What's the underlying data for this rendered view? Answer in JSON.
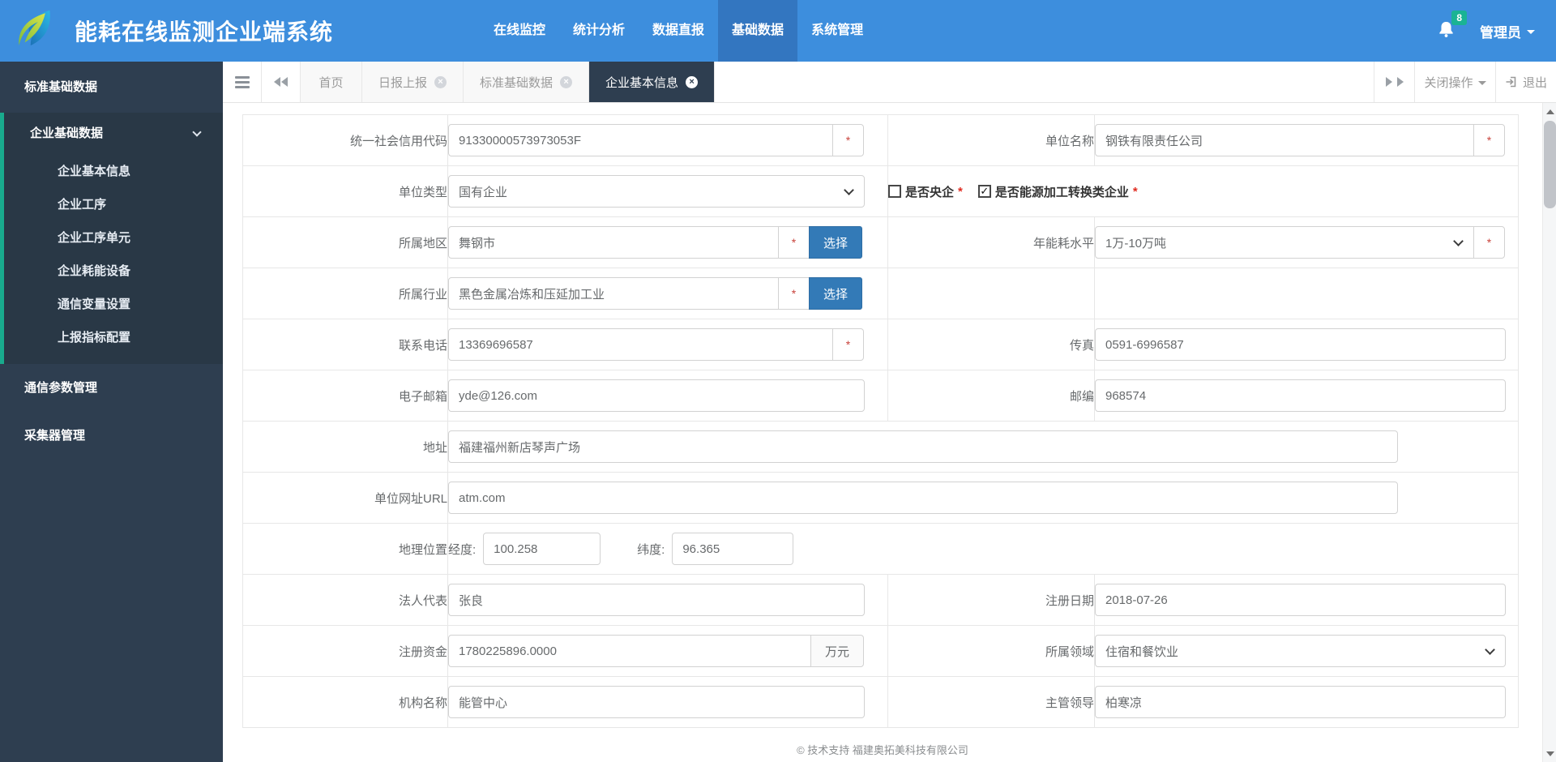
{
  "header": {
    "title": "能耗在线监测企业端系统",
    "nav": [
      {
        "label": "在线监控",
        "active": false
      },
      {
        "label": "统计分析",
        "active": false
      },
      {
        "label": "数据直报",
        "active": false
      },
      {
        "label": "基础数据",
        "active": true
      },
      {
        "label": "系统管理",
        "active": false
      }
    ],
    "badge": "8",
    "user": "管理员"
  },
  "tabbar": {
    "tabs": [
      {
        "label": "首页",
        "closable": false,
        "active": false
      },
      {
        "label": "日报上报",
        "closable": true,
        "active": false
      },
      {
        "label": "标准基础数据",
        "closable": true,
        "active": false
      },
      {
        "label": "企业基本信息",
        "closable": true,
        "active": true
      }
    ],
    "close_menu": "关闭操作",
    "logout": "退出",
    "close_glyph": "×"
  },
  "sidebar": {
    "section": "标准基础数据",
    "group": "企业基础数据",
    "items": [
      "企业基本信息",
      "企业工序",
      "企业工序单元",
      "企业耗能设备",
      "通信变量设置",
      "上报指标配置"
    ],
    "others": [
      "通信参数管理",
      "采集器管理"
    ]
  },
  "form": {
    "usci": {
      "label": "统一社会信用代码",
      "value": "91330000573973053F",
      "required": "*"
    },
    "org_name": {
      "label": "单位名称",
      "value": "钢铁有限责任公司",
      "required": "*"
    },
    "org_type": {
      "label": "单位类型",
      "value": "国有企业"
    },
    "is_central": {
      "label": "是否央企",
      "required": "*",
      "checked": false
    },
    "is_energy_conv": {
      "label": "是否能源加工转换类企业",
      "required": "*",
      "checked": true
    },
    "region": {
      "label": "所属地区",
      "value": "舞钢市",
      "required": "*",
      "button": "选择"
    },
    "energy_level": {
      "label": "年能耗水平",
      "value": "1万-10万吨",
      "required": "*"
    },
    "industry": {
      "label": "所属行业",
      "value": "黑色金属冶炼和压延加工业",
      "required": "*",
      "button": "选择"
    },
    "phone": {
      "label": "联系电话",
      "value": "13369696587",
      "required": "*"
    },
    "fax": {
      "label": "传真",
      "value": "0591-6996587"
    },
    "email": {
      "label": "电子邮箱",
      "value": "yde@126.com"
    },
    "postcode": {
      "label": "邮编",
      "value": "968574"
    },
    "address": {
      "label": "地址",
      "value": "福建福州新店琴声广场"
    },
    "website": {
      "label": "单位网址URL",
      "value": "atm.com"
    },
    "geo": {
      "label": "地理位置",
      "lng_label": "经度:",
      "lng": "100.258",
      "lat_label": "纬度:",
      "lat": "96.365"
    },
    "legal_rep": {
      "label": "法人代表",
      "value": "张良"
    },
    "reg_date": {
      "label": "注册日期",
      "value": "2018-07-26"
    },
    "reg_capital": {
      "label": "注册资金",
      "value": "1780225896.0000",
      "unit": "万元"
    },
    "domain": {
      "label": "所属领域",
      "value": "住宿和餐饮业"
    },
    "org_title": {
      "label": "机构名称",
      "value": "能管中心"
    },
    "leader": {
      "label": "主管领导",
      "value": "柏寒凉"
    }
  },
  "footer": "© 技术支持 福建奥拓美科技有限公司",
  "colors": {
    "header_blue": "#3d8edd",
    "nav_active_blue": "#3376c0",
    "sidebar_dark": "#2e3e50",
    "sidebar_sub_dark": "#293846",
    "accent_green": "#19aa8d",
    "badge_green": "#1ab394",
    "primary_button": "#337ab7",
    "required_red": "#e02b20",
    "border_gray": "#e7e7e7"
  }
}
